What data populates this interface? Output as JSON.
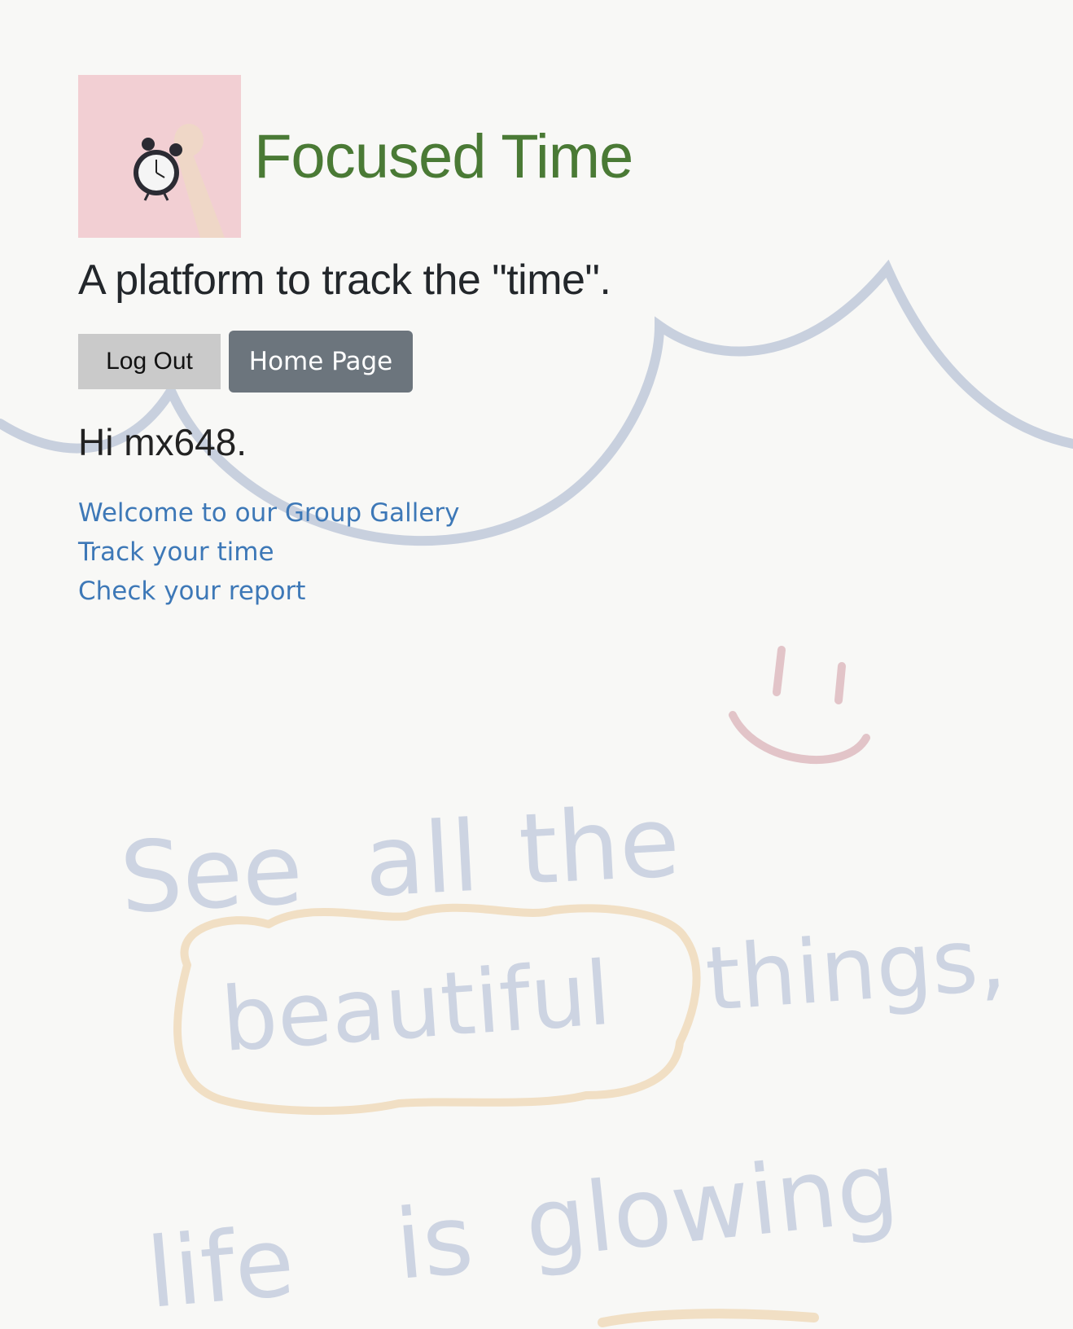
{
  "header": {
    "title": "Focused Time",
    "subtitle": "A platform to track the \"time\"."
  },
  "actions": {
    "logout_label": "Log Out",
    "home_label": "Home Page"
  },
  "greeting": "Hi mx648.",
  "links": [
    {
      "label": "Welcome to our Group Gallery"
    },
    {
      "label": "Track your time"
    },
    {
      "label": "Check your report"
    }
  ],
  "background": {
    "handwriting": {
      "line1_a": "See",
      "line1_b": "all",
      "line1_c": "the",
      "line2_a": "beautiful",
      "line2_b": "things,",
      "line3_a": "life",
      "line3_b": "is",
      "line3_c": "glowing"
    }
  },
  "colors": {
    "title": "#4a7a35",
    "link": "#3d78b7",
    "home_button": "#6c757d",
    "logout_button": "#cacaca",
    "background": "#f8f8f6"
  }
}
